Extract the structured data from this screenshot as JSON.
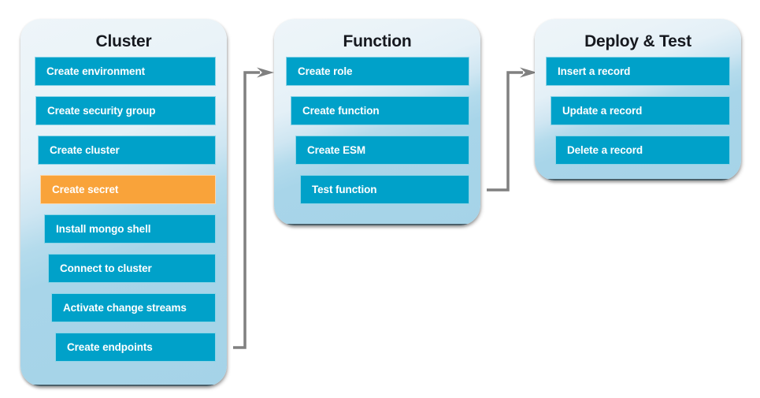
{
  "diagram": {
    "title": "Cluster / Function / Deploy & Test workflow",
    "colors": {
      "step_blue": "#00a1c9",
      "step_highlight_orange": "#f9a33a",
      "panel_top": "#eef5f9",
      "panel_bottom": "#a5d3e8",
      "connector_gray": "#808080",
      "title_text": "#16191f",
      "step_text": "#ffffff"
    },
    "columns": [
      {
        "id": "cluster",
        "title": "Cluster",
        "steps": [
          {
            "label": "Create environment",
            "state": "default"
          },
          {
            "label": "Create security group",
            "state": "default"
          },
          {
            "label": "Create cluster",
            "state": "default"
          },
          {
            "label": "Create secret",
            "state": "highlighted"
          },
          {
            "label": "Install mongo shell",
            "state": "default"
          },
          {
            "label": "Connect to cluster",
            "state": "default"
          },
          {
            "label": "Activate change streams",
            "state": "default"
          },
          {
            "label": "Create endpoints",
            "state": "default"
          }
        ]
      },
      {
        "id": "function",
        "title": "Function",
        "steps": [
          {
            "label": "Create role",
            "state": "default"
          },
          {
            "label": "Create function",
            "state": "default"
          },
          {
            "label": "Create ESM",
            "state": "default"
          },
          {
            "label": "Test function",
            "state": "default"
          }
        ]
      },
      {
        "id": "deploy-test",
        "title": "Deploy & Test",
        "steps": [
          {
            "label": "Insert a record",
            "state": "default"
          },
          {
            "label": "Update a record",
            "state": "default"
          },
          {
            "label": "Delete a record",
            "state": "default"
          }
        ]
      }
    ],
    "connectors": [
      {
        "id": "cluster-to-function",
        "from": "Create endpoints",
        "to": "Create role"
      },
      {
        "id": "function-to-deploy",
        "from": "Test function",
        "to": "Insert a record"
      }
    ]
  }
}
